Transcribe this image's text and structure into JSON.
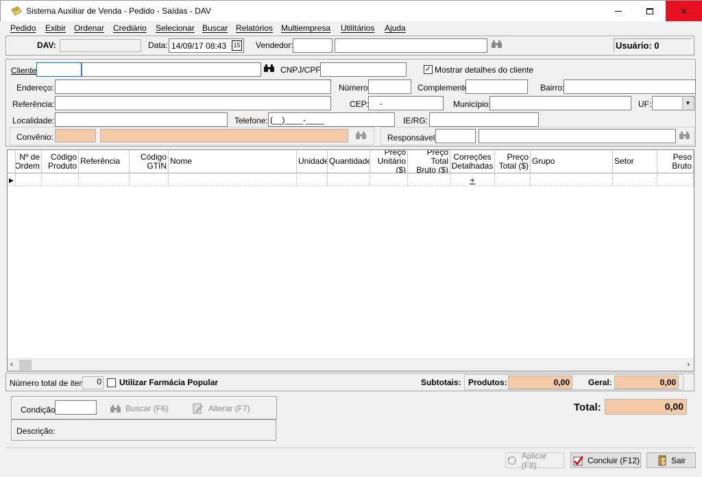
{
  "window": {
    "title": "Sistema Auxiliar de Venda - Pedido - Saídas - DAV",
    "minimize": "—",
    "maximize": "☐",
    "close": "✕"
  },
  "menu": [
    "Pedido",
    "Exibir",
    "Ordenar",
    "Crediário",
    "Selecionar",
    "Buscar",
    "Relatórios",
    "Multiempresa",
    "Utilitários",
    "Ajuda"
  ],
  "header": {
    "dav_label": "DAV:",
    "dav_value": "",
    "data_label": "Data:",
    "data_value": "14/09/17 08:43",
    "calendar_glyph": "15",
    "vendedor_label": "Vendedor:",
    "vendedor_code": "",
    "vendedor_name": "",
    "usuario": "Usuário: 0"
  },
  "client": {
    "cliente_label": "Cliente:",
    "cliente_code": "",
    "cliente_name": "",
    "cnpj_label": "CNPJ/CPF:",
    "cnpj_value": "",
    "mostrar_label": "Mostrar detalhes do cliente",
    "mostrar_checked": true,
    "endereco_label": "Endereço:",
    "numero_label": "Número:",
    "complemento_label": "Complemento:",
    "bairro_label": "Bairro:",
    "referencia_label": "Referência:",
    "cep_label": "CEP:",
    "cep_value": "-",
    "municipio_label": "Município:",
    "uf_label": "UF:",
    "localidade_label": "Localidade:",
    "telefone_label": "Telefone:",
    "telefone_value": "(__)____-____",
    "ie_label": "IE/RG:",
    "convenio_label": "Convênio:",
    "responsavel_label": "Responsável:"
  },
  "grid": {
    "columns": [
      {
        "l1": "Nº de",
        "l2": "Ordem"
      },
      {
        "l1": "Código",
        "l2": "Produto"
      },
      {
        "l1": "Referência",
        "l2": ""
      },
      {
        "l1": "Código",
        "l2": "GTIN"
      },
      {
        "l1": "Nome",
        "l2": ""
      },
      {
        "l1": "Unidade",
        "l2": ""
      },
      {
        "l1": "Quantidade",
        "l2": ""
      },
      {
        "l1": "Preço",
        "l2": "Unitário ($)"
      },
      {
        "l1": "Preço",
        "l2": "Total Bruto ($)"
      },
      {
        "l1": "Correções",
        "l2": "Detalhadas"
      },
      {
        "l1": "Preço",
        "l2": "Total ($)"
      },
      {
        "l1": "Grupo",
        "l2": ""
      },
      {
        "l1": "Setor",
        "l2": ""
      },
      {
        "l1": "Peso",
        "l2": "Bruto"
      }
    ],
    "row_marker": "▶",
    "expand_glyph": "+"
  },
  "footer": {
    "num_itens_label": "Número total de itens:",
    "num_itens_value": "0",
    "farmacia_label": "Utilizar Farmácia Popular",
    "farmacia_checked": false,
    "subtotais_label": "Subtotais:",
    "produtos_label": "Produtos:",
    "produtos_value": "0,00",
    "geral_label": "Geral:",
    "geral_value": "0,00",
    "condicao_label": "Condição:",
    "buscar_label": "Buscar (F6)",
    "alterar_label": "Alterar (F7)",
    "descricao_label": "Descrição:",
    "total_label": "Total:",
    "total_value": "0,00"
  },
  "buttons": {
    "aplicar": "Aplicar (F8)",
    "concluir": "Concluir (F12)",
    "sair": "Sair"
  }
}
